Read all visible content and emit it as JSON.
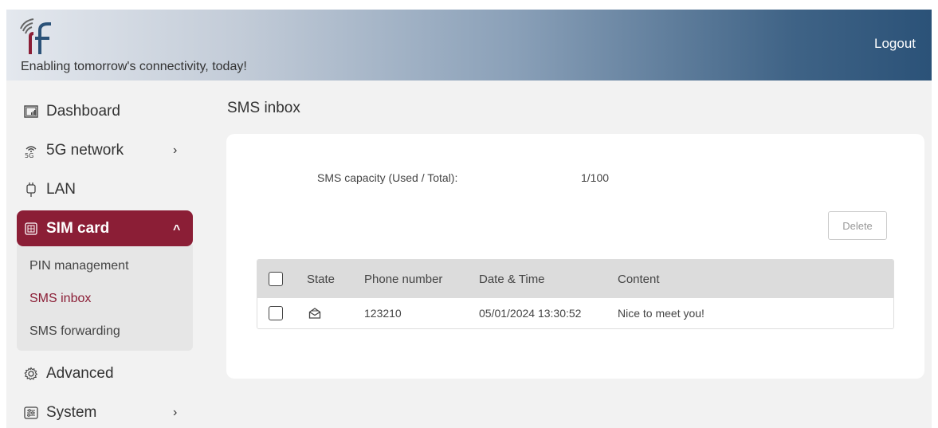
{
  "header": {
    "tagline": "Enabling tomorrow's connectivity, today!",
    "logout_label": "Logout"
  },
  "sidebar": {
    "items": [
      {
        "label": "Dashboard",
        "icon": "dashboard-icon"
      },
      {
        "label": "5G network",
        "icon": "5g-icon",
        "arrow": "›"
      },
      {
        "label": "LAN",
        "icon": "lan-icon"
      },
      {
        "label": "SIM card",
        "icon": "sim-card-icon",
        "arrow": "^"
      },
      {
        "label": "Advanced",
        "icon": "gear-icon"
      },
      {
        "label": "System",
        "icon": "system-icon",
        "arrow": "›"
      }
    ],
    "sim_submenu": [
      "PIN management",
      "SMS inbox",
      "SMS forwarding"
    ]
  },
  "page": {
    "title": "SMS inbox",
    "capacity_label": "SMS capacity (Used / Total):",
    "capacity_value": "1/100",
    "delete_label": "Delete"
  },
  "table": {
    "headers": [
      "State",
      "Phone number",
      "Date & Time",
      "Content"
    ],
    "rows": [
      {
        "state_icon": "envelope-open-icon",
        "phone": "123210",
        "datetime": "05/01/2024 13:30:52",
        "content": "Nice to meet you!"
      }
    ]
  },
  "colors": {
    "accent": "#8b1e36",
    "header_dark": "#2b5278"
  }
}
